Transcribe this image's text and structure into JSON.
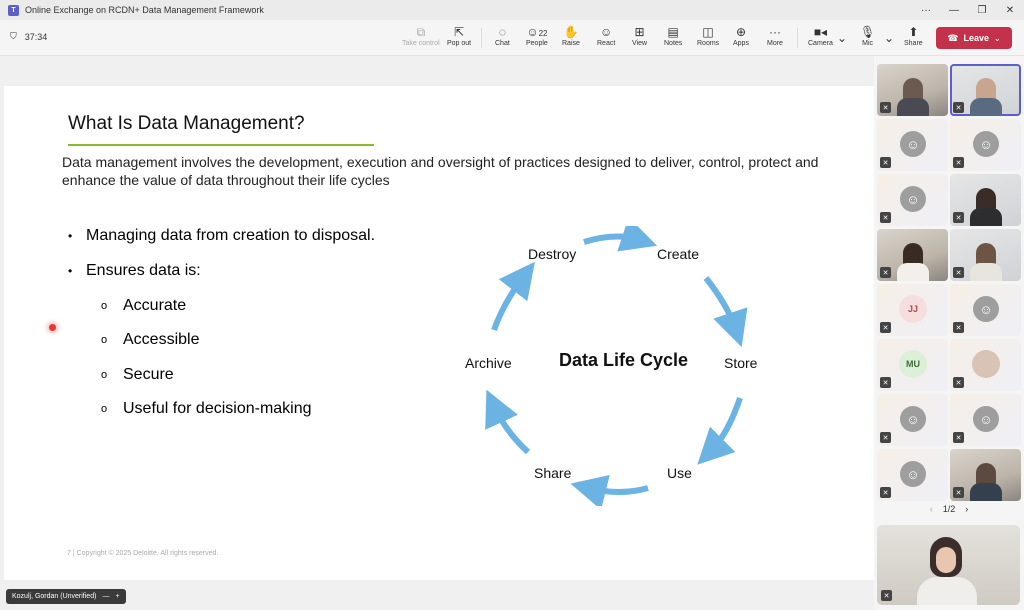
{
  "window": {
    "title": "Online Exchange on RCDN+ Data Management Framework",
    "controls": [
      "···",
      "—",
      "❐",
      "✕"
    ]
  },
  "toolbar": {
    "timer": "37:34",
    "take_control": "Take control",
    "pop_out": "Pop out",
    "chat": "Chat",
    "people": "People",
    "people_count": "22",
    "raise": "Raise",
    "react": "React",
    "view": "View",
    "notes": "Notes",
    "rooms": "Rooms",
    "apps": "Apps",
    "more": "More",
    "camera": "Camera",
    "mic": "Mic",
    "share": "Share",
    "leave": "Leave"
  },
  "slide": {
    "title": "What Is Data Management?",
    "intro": "Data management involves the development, execution and oversight of practices designed to deliver, control, protect and enhance the value of data throughout their life cycles",
    "bullets": [
      "Managing data from creation to disposal.",
      "Ensures data is:"
    ],
    "sub_bullets": [
      "Accurate",
      "Accessible",
      "Secure",
      "Useful for decision-making"
    ],
    "cycle": {
      "center": "Data Life Cycle",
      "stages": [
        "Create",
        "Store",
        "Use",
        "Share",
        "Archive",
        "Destroy"
      ],
      "arrow_color": "#6bb3e3"
    },
    "footer": "7  |  Copyright © 2025 Deloitte. All rights reserved."
  },
  "presenter": {
    "name": "Kozulj, Gordan (Unverified)"
  },
  "gallery": {
    "initials": [
      "JJ",
      "MU"
    ],
    "page": "1/2",
    "active_border": "#5b5fc7"
  },
  "brand": {
    "accent": "#86bc25",
    "leave_red": "#c4314b"
  }
}
